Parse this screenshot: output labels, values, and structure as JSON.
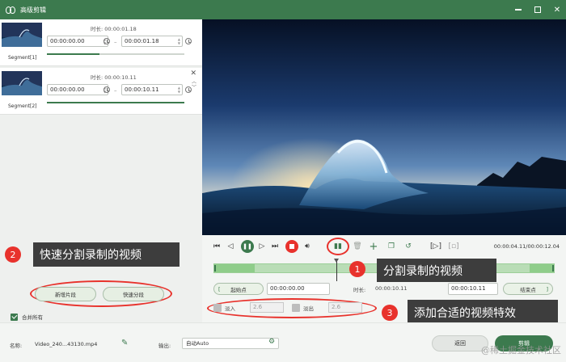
{
  "window": {
    "title": "高级剪辑"
  },
  "segments": [
    {
      "label": "Segment[1]",
      "duration_label": "时长:",
      "duration": "00:00:01.18",
      "start": "00:00:00.00",
      "end": "00:00:01.18",
      "progress": 0.38
    },
    {
      "label": "Segment[2]",
      "duration_label": "时长:",
      "duration": "00:00:10.11",
      "start": "00:00:00.00",
      "end": "00:00:10.11",
      "progress": 1.0
    }
  ],
  "left_buttons": {
    "new_segment": "新增片段",
    "quick_split": "快速分段"
  },
  "merge": {
    "label": "合并所有",
    "checked": true
  },
  "annotations": [
    {
      "num": "1",
      "text": "分割录制的视频"
    },
    {
      "num": "2",
      "text": "快速分割录制的视频"
    },
    {
      "num": "3",
      "text": "添加合适的视频特效"
    }
  ],
  "player": {
    "timecode": "00:00:04.11/00:00:12.04",
    "playhead_fraction": 0.36
  },
  "trim": {
    "start_button": "起始点",
    "start_value": "00:00:00.00",
    "duration_label": "时长:",
    "duration_value": "00:00:10.11",
    "end_value": "00:00:10.11",
    "end_button": "结束点"
  },
  "effects": {
    "fade_in_label": "淡入",
    "fade_in_value": "2.6",
    "fade_out_label": "淡出",
    "fade_out_value": "2.6"
  },
  "bottom": {
    "name_label": "名称:",
    "file_name": "Video_240...43130.mp4",
    "output_label": "输出:",
    "output_value": "自动Auto",
    "back_button": "返回",
    "cut_button": "剪辑"
  },
  "watermark": "@稀土掘金技术社区",
  "colors": {
    "accent": "#3c7a4e",
    "annotation_red": "#e8322c"
  }
}
